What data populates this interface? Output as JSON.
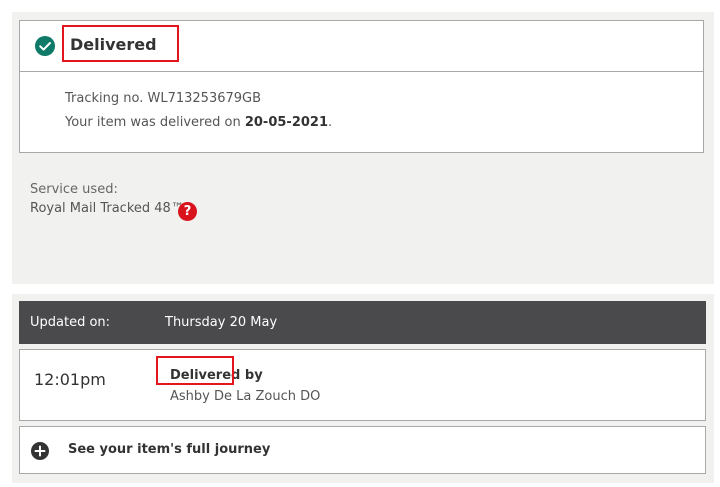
{
  "status": {
    "title": "Delivered",
    "tracking_label": "Tracking no.",
    "tracking_number": "WL713253679GB",
    "delivered_prefix": "Your item was delivered on",
    "delivered_date": "20-05-2021",
    "delivered_suffix": "."
  },
  "service": {
    "label": "Service used:",
    "name": "Royal Mail Tracked 48™",
    "help_icon": "?"
  },
  "updates": {
    "updated_label": "Updated on:",
    "updated_date": "Thursday 20 May"
  },
  "event": {
    "time": "12:01pm",
    "status": "Delivered",
    "status_suffix": " by",
    "location": "Ashby De La Zouch DO"
  },
  "journey": {
    "label": "See your item's full journey"
  },
  "colors": {
    "accent_green": "#0f7a68",
    "help_red": "#d9131b",
    "highlight_red": "#e2161c",
    "bar_dark": "#4a4a4c"
  }
}
